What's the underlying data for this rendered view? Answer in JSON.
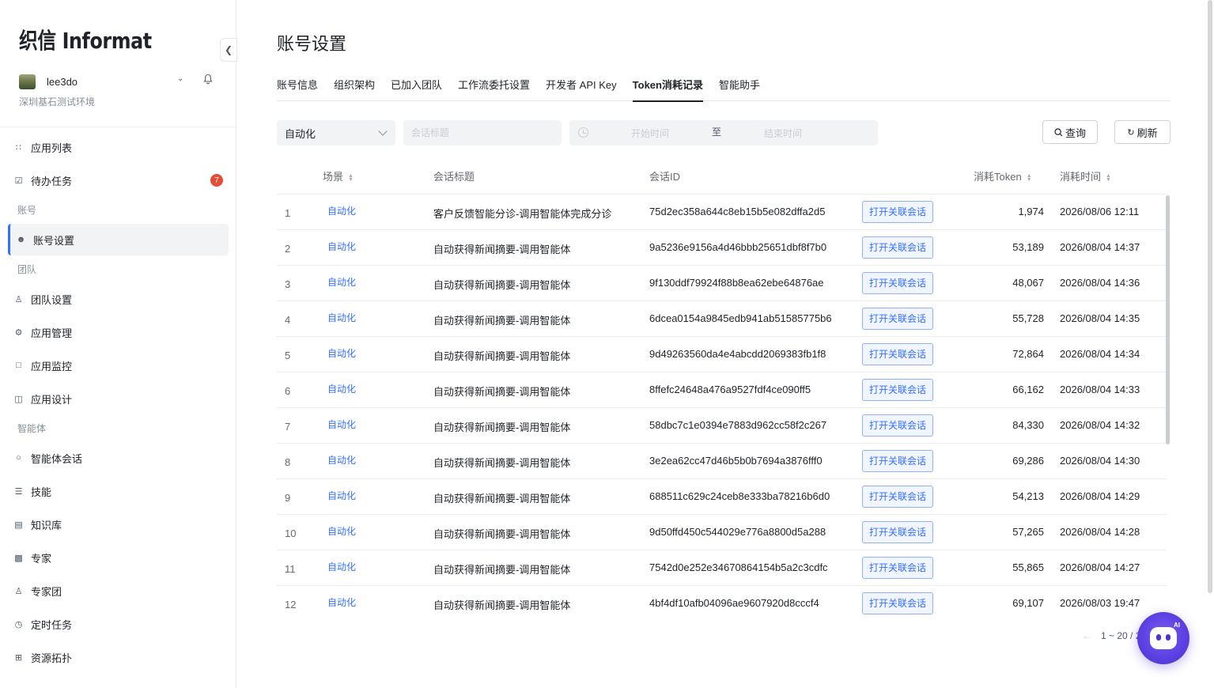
{
  "brand": {
    "logo_text": "织信 Informat"
  },
  "user": {
    "name": "lee3do",
    "org": "深圳基石测试环境"
  },
  "sidebar": {
    "items": [
      {
        "type": "item",
        "label": "应用列表",
        "icon": "grid-icon",
        "active": false
      },
      {
        "type": "item",
        "label": "待办任务",
        "icon": "checkbox-icon",
        "badge": "7",
        "active": false
      },
      {
        "type": "group",
        "label": "账号"
      },
      {
        "type": "item",
        "label": "账号设置",
        "icon": "user-icon",
        "active": true
      },
      {
        "type": "group",
        "label": "团队"
      },
      {
        "type": "item",
        "label": "团队设置",
        "icon": "team-icon",
        "active": false
      },
      {
        "type": "item",
        "label": "应用管理",
        "icon": "gear-icon",
        "active": false
      },
      {
        "type": "item",
        "label": "应用监控",
        "icon": "monitor-icon",
        "active": false
      },
      {
        "type": "item",
        "label": "应用设计",
        "icon": "design-icon",
        "active": false
      },
      {
        "type": "group",
        "label": "智能体"
      },
      {
        "type": "item",
        "label": "智能体会话",
        "icon": "chat-icon",
        "active": false
      },
      {
        "type": "item",
        "label": "技能",
        "icon": "layers-icon",
        "active": false
      },
      {
        "type": "item",
        "label": "知识库",
        "icon": "book-icon",
        "active": false
      },
      {
        "type": "item",
        "label": "专家",
        "icon": "robot-icon",
        "active": false
      },
      {
        "type": "item",
        "label": "专家团",
        "icon": "group-icon",
        "active": false
      },
      {
        "type": "item",
        "label": "定时任务",
        "icon": "calendar-clock-icon",
        "active": false
      },
      {
        "type": "item",
        "label": "资源拓扑",
        "icon": "topology-icon",
        "active": false
      }
    ]
  },
  "page": {
    "title": "账号设置"
  },
  "tabs": [
    {
      "label": "账号信息",
      "active": false
    },
    {
      "label": "组织架构",
      "active": false
    },
    {
      "label": "已加入团队",
      "active": false
    },
    {
      "label": "工作流委托设置",
      "active": false
    },
    {
      "label": "开发者 API Key",
      "active": false
    },
    {
      "label": "Token消耗记录",
      "active": true
    },
    {
      "label": "智能助手",
      "active": false
    }
  ],
  "filters": {
    "scene_value": "自动化",
    "title_placeholder": "会话标题",
    "start_placeholder": "开始时间",
    "range_separator": "至",
    "end_placeholder": "结束时间",
    "query_label": "查询",
    "refresh_label": "刷新"
  },
  "table": {
    "columns": {
      "scene": "场景",
      "title": "会话标题",
      "id": "会话ID",
      "token": "消耗Token",
      "time": "消耗时间"
    },
    "open_label": "打开关联会话",
    "rows": [
      {
        "idx": "1",
        "scene": "自动化",
        "title": "客户反馈智能分诊-调用智能体完成分诊",
        "id": "75d2ec358a644c8eb15b5e082dffa2d5",
        "token": "1,974",
        "time": "2026/08/06 12:11"
      },
      {
        "idx": "2",
        "scene": "自动化",
        "title": "自动获得新闻摘要-调用智能体",
        "id": "9a5236e9156a4d46bbb25651dbf8f7b0",
        "token": "53,189",
        "time": "2026/08/04 14:37"
      },
      {
        "idx": "3",
        "scene": "自动化",
        "title": "自动获得新闻摘要-调用智能体",
        "id": "9f130ddf79924f88b8ea62ebe64876ae",
        "token": "48,067",
        "time": "2026/08/04 14:36"
      },
      {
        "idx": "4",
        "scene": "自动化",
        "title": "自动获得新闻摘要-调用智能体",
        "id": "6dcea0154a9845edb941ab51585775b6",
        "token": "55,728",
        "time": "2026/08/04 14:35"
      },
      {
        "idx": "5",
        "scene": "自动化",
        "title": "自动获得新闻摘要-调用智能体",
        "id": "9d49263560da4e4abcdd2069383fb1f8",
        "token": "72,864",
        "time": "2026/08/04 14:34"
      },
      {
        "idx": "6",
        "scene": "自动化",
        "title": "自动获得新闻摘要-调用智能体",
        "id": "8ffefc24648a476a9527fdf4ce090ff5",
        "token": "66,162",
        "time": "2026/08/04 14:33"
      },
      {
        "idx": "7",
        "scene": "自动化",
        "title": "自动获得新闻摘要-调用智能体",
        "id": "58dbc7c1e0394e7883d962cc58f2c267",
        "token": "84,330",
        "time": "2026/08/04 14:32"
      },
      {
        "idx": "8",
        "scene": "自动化",
        "title": "自动获得新闻摘要-调用智能体",
        "id": "3e2ea62cc47d46b5b0b7694a3876fff0",
        "token": "69,286",
        "time": "2026/08/04 14:30"
      },
      {
        "idx": "9",
        "scene": "自动化",
        "title": "自动获得新闻摘要-调用智能体",
        "id": "688511c629c24ceb8e333ba78216b6d0",
        "token": "54,213",
        "time": "2026/08/04 14:29"
      },
      {
        "idx": "10",
        "scene": "自动化",
        "title": "自动获得新闻摘要-调用智能体",
        "id": "9d50ffd450c544029e776a8800d5a288",
        "token": "57,265",
        "time": "2026/08/04 14:28"
      },
      {
        "idx": "11",
        "scene": "自动化",
        "title": "自动获得新闻摘要-调用智能体",
        "id": "7542d0e252e34670864154b5a2c3cdfc",
        "token": "55,865",
        "time": "2026/08/04 14:27"
      },
      {
        "idx": "12",
        "scene": "自动化",
        "title": "自动获得新闻摘要-调用智能体",
        "id": "4bf4df10afb04096ae9607920d8cccf4",
        "token": "69,107",
        "time": "2026/08/03 19:47"
      }
    ]
  },
  "pagination": {
    "text": "1 ~ 20 / 22"
  },
  "assistant": {
    "tag": "AI"
  },
  "colors": {
    "accent": "#3370ff",
    "badge": "#e34d37",
    "assistant": "#5b3fe0"
  }
}
